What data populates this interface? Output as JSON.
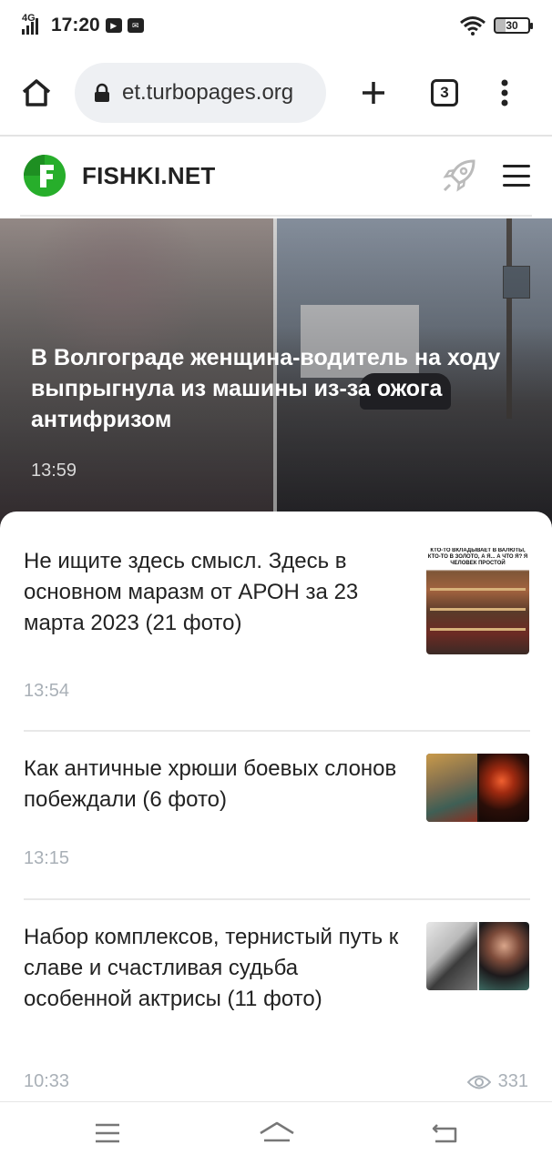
{
  "status_bar": {
    "network": "4G",
    "time": "17:20",
    "battery": "30"
  },
  "browser": {
    "url": "et.turbopages.org",
    "tab_count": "3"
  },
  "site": {
    "name": "FISHKI.NET",
    "brand_color": "#27ae2b"
  },
  "hero": {
    "title": "В Волгограде женщина-водитель на ходу выпрыгнула из машины из-за ожога антифризом",
    "time": "13:59"
  },
  "feed": {
    "items": [
      {
        "title": "Не ищите здесь смысл. Здесь в основном маразм от АРОН за 23 марта 2023 (21 фото)",
        "time": "13:54",
        "thumb_caption": "КТО-ТО ВКЛАДЫВАЕТ В ВАЛЮТЫ, КТО-ТО В ЗОЛОТО, А Я... А ЧТО Я? Я ЧЕЛОВЕК ПРОСТОЙ"
      },
      {
        "title": "Как античные хрюши боевых слонов побеждали (6 фото)",
        "time": "13:15"
      },
      {
        "title": "Набор комплексов, тернистый путь к славе и счастливая судьба особенной актрисы (11 фото)",
        "time": "10:33",
        "views": "331"
      }
    ]
  }
}
